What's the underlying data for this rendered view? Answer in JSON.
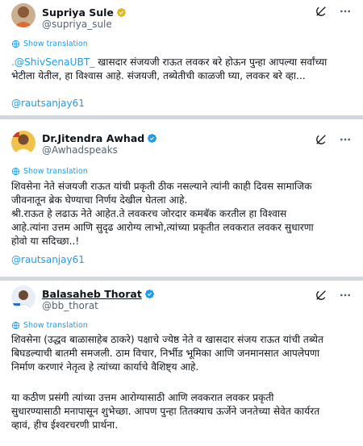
{
  "tweets": [
    {
      "name": "Supriya Sule",
      "handle": "@supriya_sule",
      "translate_label": "Show translation",
      "mention": ".@ShivSenaUBT_",
      "text_line1_rest": " खासदार संजयजी राऊत लवकर बरे होऊन पुन्हा आपल्या सर्वांच्या",
      "text_line2": "भेटीला येतील, हा विश्वास आहे. संजयजी, तब्येतीची काळजी घ्या, लवकर बरे व्हा...",
      "footer_mention": "@rautsanjay61"
    },
    {
      "name": "Dr.Jitendra Awhad",
      "handle": "@Awhadspeaks",
      "translate_label": "Show translation",
      "text": "शिवसेना नेते संजयजी राऊत यांची प्रकृती ठीक नसल्याने त्यांनी काही दिवस सामाजिक\nजीवनातून ब्रेक घेण्याचा निर्णय देखील घेतला आहे.\nश्री.राऊत हे लढाऊ नेते आहेत.ते लवकरच जोरदार कमबॅक करतील हा विश्वास\nआहे.त्यांना उत्तम आणि सुदृढ आरोग्य लाभो,त्यांच्या प्रकृतीत लवकरात लवकर सुधारणा\nहोवो या सदिच्छा..!",
      "footer_mention": "@rautsanjay61"
    },
    {
      "name": "Balasaheb Thorat",
      "handle": "@bb_thorat",
      "translate_label": "Show translation",
      "text1": "शिवसेना (उद्धव बाळासाहेब ठाकरे) पक्षाचे ज्येष्ठ नेते व खासदार संजय राऊत यांची तब्येत\nबिघडल्याची बातमी समजली. ठाम विचार, निर्भीड भूमिका आणि जनमानसात आपलेपणा\nनिर्माण करणारं नेतृत्व हे त्यांच्या कार्याचे वैशिष्ट्य आहे.",
      "text2": "या कठीण प्रसंगी त्यांच्या उत्तम आरोग्यासाठी आणि लवकरात लवकर प्रकृती\nसुधारण्यासाठी मनापासून शुभेच्छा. आपण पुन्हा तितक्याच ऊर्जेने जनतेच्या सेवेत कार्यरत\nव्हावं, हीच ईश्वरचरणी प्रार्थना."
    }
  ],
  "colors": {
    "link": "#1d9bf0",
    "verified_blue": "#1d9bf0",
    "verified_gold": "#e2b719",
    "separator": "#cfd9de"
  },
  "icons": [
    "grok-icon",
    "more-icon",
    "globe-translate-icon",
    "verified-badge-icon"
  ]
}
